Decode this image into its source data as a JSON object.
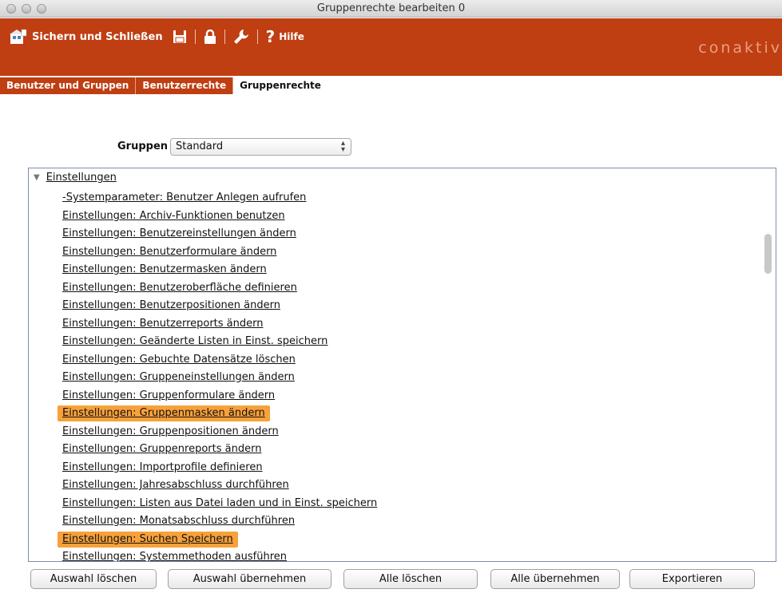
{
  "window": {
    "title": "Gruppenrechte bearbeiten 0"
  },
  "toolbar": {
    "save_close_label": "Sichern und Schließen",
    "help_label": "Hilfe",
    "logo": "conaktiv",
    "accent": "#bf3e12"
  },
  "tabs": [
    {
      "label": "Benutzer und Gruppen"
    },
    {
      "label": "Benutzerrechte"
    },
    {
      "label": "Gruppenrechte"
    }
  ],
  "groups": {
    "label": "Gruppen",
    "selected": "Standard"
  },
  "tree": {
    "parent": "Einstellungen",
    "items": [
      {
        "label": "-Systemparameter: Benutzer Anlegen aufrufen"
      },
      {
        "label": "Einstellungen: Archiv-Funktionen benutzen"
      },
      {
        "label": "Einstellungen: Benutzereinstellungen ändern"
      },
      {
        "label": "Einstellungen: Benutzerformulare ändern"
      },
      {
        "label": "Einstellungen: Benutzermasken ändern"
      },
      {
        "label": "Einstellungen: Benutzeroberfläche definieren"
      },
      {
        "label": "Einstellungen: Benutzerpositionen ändern"
      },
      {
        "label": "Einstellungen: Benutzerreports ändern"
      },
      {
        "label": "Einstellungen: Geänderte Listen in Einst. speichern"
      },
      {
        "label": "Einstellungen: Gebuchte Datensätze löschen"
      },
      {
        "label": "Einstellungen: Gruppeneinstellungen ändern"
      },
      {
        "label": "Einstellungen: Gruppenformulare ändern"
      },
      {
        "label": "Einstellungen: Gruppenmasken ändern"
      },
      {
        "label": "Einstellungen: Gruppenpositionen ändern"
      },
      {
        "label": "Einstellungen: Gruppenreports ändern"
      },
      {
        "label": "Einstellungen: Importprofile definieren"
      },
      {
        "label": "Einstellungen: Jahresabschluss durchführen"
      },
      {
        "label": "Einstellungen: Listen aus Datei laden und in Einst. speichern"
      },
      {
        "label": "Einstellungen: Monatsabschluss durchführen"
      },
      {
        "label": "Einstellungen: Suchen Speichern"
      },
      {
        "label": "Einstellungen: Systemmethoden ausführen"
      }
    ],
    "highlight_color": "#f7a13a"
  },
  "buttons": {
    "clear_selection": "Auswahl löschen",
    "apply_selection": "Auswahl übernehmen",
    "delete_all": "Alle löschen",
    "apply_all": "Alle übernehmen",
    "export": "Exportieren"
  }
}
